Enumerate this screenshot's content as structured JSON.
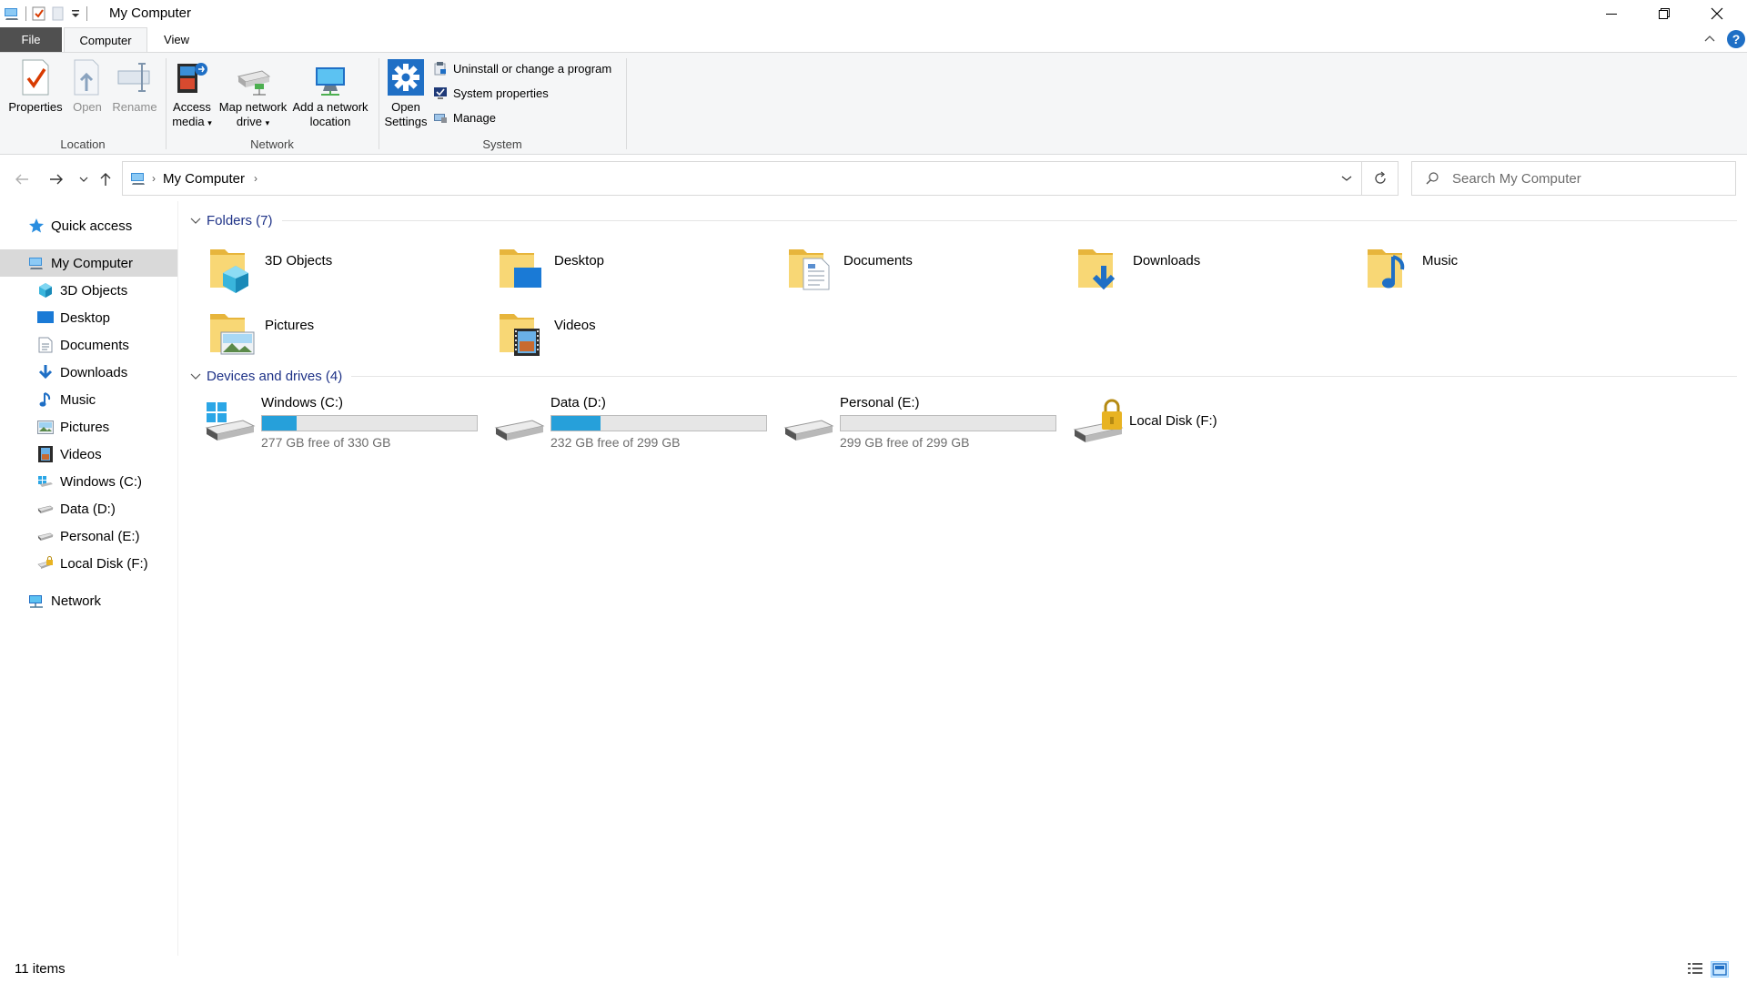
{
  "window": {
    "title": "My Computer",
    "buttons": {
      "minimize": "minimize",
      "maximize": "restore",
      "close": "close"
    }
  },
  "ribbon_tabs": [
    {
      "label": "File"
    },
    {
      "label": "Computer",
      "selected": true
    },
    {
      "label": "View"
    }
  ],
  "ribbon": {
    "location": {
      "group_label": "Location",
      "properties": "Properties",
      "open": "Open",
      "rename": "Rename"
    },
    "network": {
      "group_label": "Network",
      "access_media_1": "Access",
      "access_media_2": "media",
      "map_drive_1": "Map network",
      "map_drive_2": "drive",
      "add_location_1": "Add a network",
      "add_location_2": "location"
    },
    "system": {
      "group_label": "System",
      "open_settings_1": "Open",
      "open_settings_2": "Settings",
      "uninstall": "Uninstall or change a program",
      "system_properties": "System properties",
      "manage": "Manage"
    }
  },
  "address": {
    "path": "My Computer",
    "search_placeholder": "Search My Computer"
  },
  "sidebar": {
    "quick_access": "Quick access",
    "items": [
      {
        "label": "My Computer",
        "icon": "computer-icon",
        "selected": true
      },
      {
        "label": "3D Objects",
        "icon": "3d-objects-icon"
      },
      {
        "label": "Desktop",
        "icon": "desktop-icon"
      },
      {
        "label": "Documents",
        "icon": "documents-icon"
      },
      {
        "label": "Downloads",
        "icon": "downloads-icon"
      },
      {
        "label": "Music",
        "icon": "music-icon"
      },
      {
        "label": "Pictures",
        "icon": "pictures-icon"
      },
      {
        "label": "Videos",
        "icon": "videos-icon"
      },
      {
        "label": "Windows (C:)",
        "icon": "windows-drive-icon"
      },
      {
        "label": "Data (D:)",
        "icon": "drive-icon"
      },
      {
        "label": "Personal (E:)",
        "icon": "drive-icon"
      },
      {
        "label": "Local Disk (F:)",
        "icon": "locked-drive-icon"
      }
    ],
    "network": "Network"
  },
  "content": {
    "folders_header": "Folders (7)",
    "folders": [
      {
        "label": "3D Objects",
        "icon": "3d-objects-folder-icon"
      },
      {
        "label": "Desktop",
        "icon": "desktop-folder-icon"
      },
      {
        "label": "Documents",
        "icon": "documents-folder-icon"
      },
      {
        "label": "Downloads",
        "icon": "downloads-folder-icon"
      },
      {
        "label": "Music",
        "icon": "music-folder-icon"
      },
      {
        "label": "Pictures",
        "icon": "pictures-folder-icon"
      },
      {
        "label": "Videos",
        "icon": "videos-folder-icon"
      }
    ],
    "drives_header": "Devices and drives (4)",
    "drives": [
      {
        "label": "Windows (C:)",
        "free": "277 GB free of 330 GB",
        "used_fraction": 0.16,
        "icon": "windows-drive-icon"
      },
      {
        "label": "Data (D:)",
        "free": "232 GB free of 299 GB",
        "used_fraction": 0.23,
        "icon": "drive-icon"
      },
      {
        "label": "Personal (E:)",
        "free": "299 GB free of 299 GB",
        "used_fraction": 0.0,
        "icon": "drive-icon"
      },
      {
        "label": "Local Disk (F:)",
        "free": "",
        "icon": "locked-drive-icon"
      }
    ]
  },
  "status": {
    "item_count": "11 items"
  },
  "colors": {
    "accent": "#26a0da",
    "selection": "#cce8ff",
    "section_header": "#1e3287",
    "file_tab": "#505050"
  }
}
